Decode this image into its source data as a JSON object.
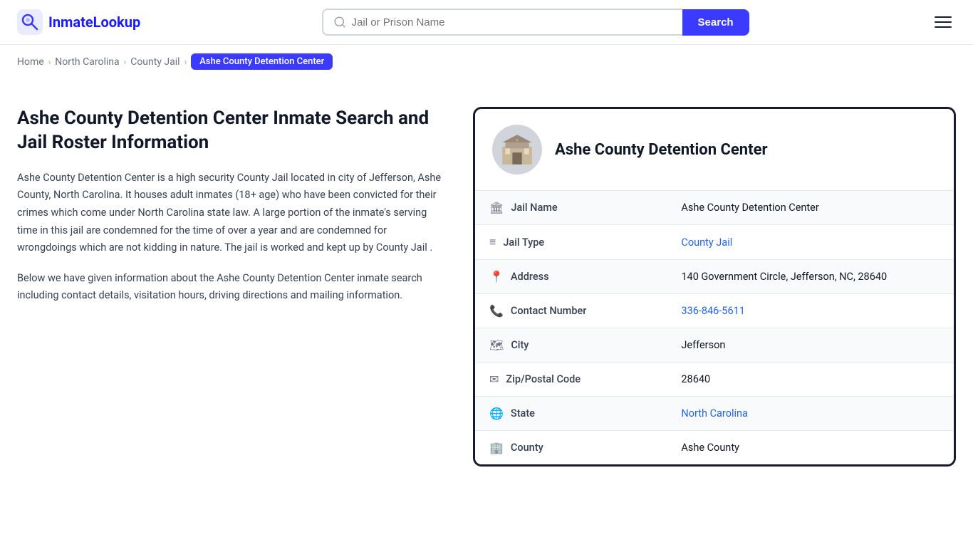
{
  "logo": {
    "text": "InmateLookup",
    "icon_label": "inmate-lookup-logo"
  },
  "search": {
    "placeholder": "Jail or Prison Name",
    "button_label": "Search"
  },
  "breadcrumb": {
    "home": "Home",
    "state": "North Carolina",
    "category": "County Jail",
    "current": "Ashe County Detention Center"
  },
  "page": {
    "title": "Ashe County Detention Center Inmate Search and Jail Roster Information",
    "description1": "Ashe County Detention Center is a high security County Jail located in city of Jefferson, Ashe County, North Carolina. It houses adult inmates (18+ age) who have been convicted for their crimes which come under North Carolina state law. A large portion of the inmate's serving time in this jail are condemned for the time of over a year and are condemned for wrongdoings which are not kidding in nature. The jail is worked and kept up by County Jail .",
    "description2": "Below we have given information about the Ashe County Detention Center inmate search including contact details, visitation hours, driving directions and mailing information."
  },
  "facility": {
    "name": "Ashe County Detention Center",
    "details": [
      {
        "label": "Jail Name",
        "value": "Ashe County Detention Center",
        "link": null,
        "icon": "🏛"
      },
      {
        "label": "Jail Type",
        "value": "County Jail",
        "link": "#",
        "icon": "≡"
      },
      {
        "label": "Address",
        "value": "140 Government Circle, Jefferson, NC, 28640",
        "link": null,
        "icon": "📍"
      },
      {
        "label": "Contact Number",
        "value": "336-846-5611",
        "link": "tel:336-846-5611",
        "icon": "📞"
      },
      {
        "label": "City",
        "value": "Jefferson",
        "link": null,
        "icon": "🗺"
      },
      {
        "label": "Zip/Postal Code",
        "value": "28640",
        "link": null,
        "icon": "✉"
      },
      {
        "label": "State",
        "value": "North Carolina",
        "link": "#",
        "icon": "🌐"
      },
      {
        "label": "County",
        "value": "Ashe County",
        "link": null,
        "icon": "🏢"
      }
    ]
  }
}
